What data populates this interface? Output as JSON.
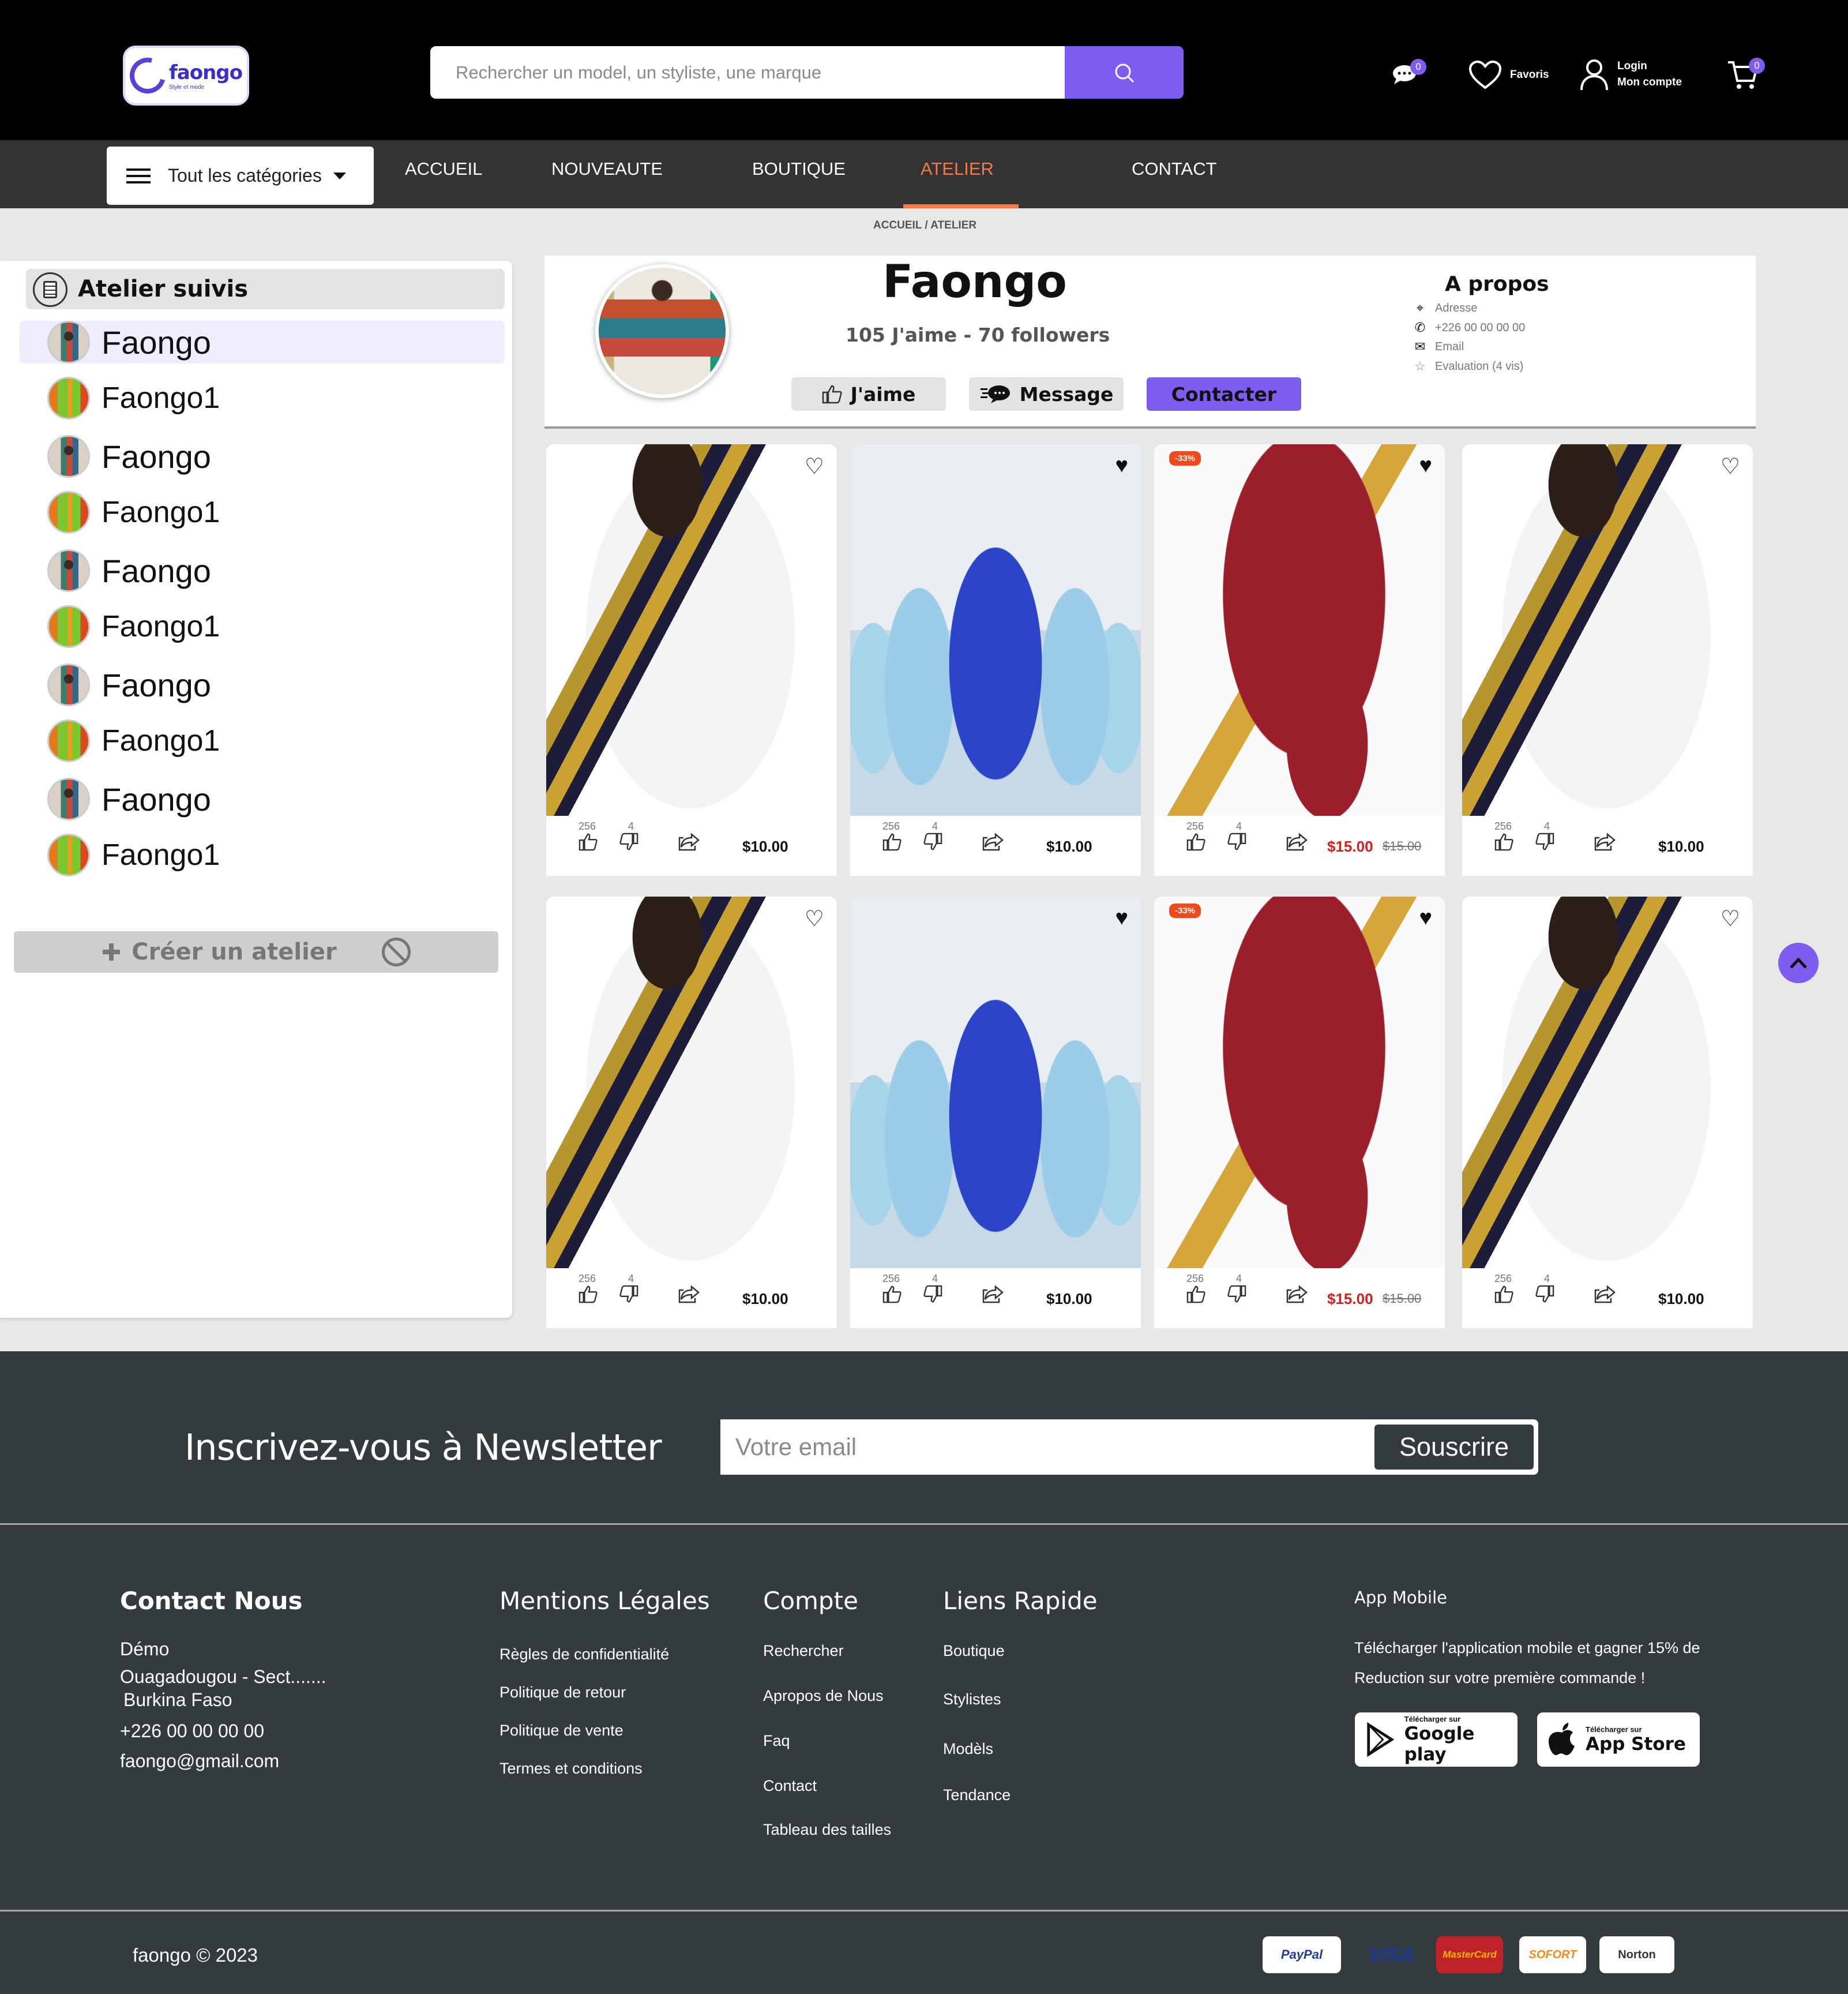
{
  "header": {
    "logo_text": "faongo",
    "logo_tagline": "Style et mode",
    "search_placeholder": "Rechercher un model, un styliste, une marque",
    "messages_badge": "0",
    "favorites_label": "Favoris",
    "login_label": "Login",
    "account_label": "Mon compte",
    "cart_badge": "0"
  },
  "nav": {
    "categories_label": "Tout les catégories",
    "items": [
      "ACCUEIL",
      "NOUVEAUTE",
      "BOUTIQUE",
      "ATELIER",
      "CONTACT"
    ],
    "active": "ATELIER",
    "accent_color": "#f07a4a"
  },
  "breadcrumb": "ACCUEIL / ATELIER",
  "sidebar": {
    "title": "Atelier suivis",
    "items": [
      "Faongo",
      "Faongo1",
      "Faongo",
      "Faongo1",
      "Faongo",
      "Faongo1",
      "Faongo",
      "Faongo1",
      "Faongo",
      "Faongo1"
    ],
    "create_label": "Créer un atelier"
  },
  "profile": {
    "name": "Faongo",
    "stats": "105 J'aime  -  70 followers",
    "like_label": "J'aime",
    "message_label": "Message",
    "contact_label": "Contacter",
    "about": {
      "title": "A propos",
      "address": "Adresse",
      "phone": "+226 00 00 00 00",
      "email": "Email",
      "rating": "Evaluation (4 vis)"
    }
  },
  "products": [
    {
      "image": "white-shirt",
      "liked": false,
      "discount": "",
      "likes": "256",
      "dislikes": "4",
      "price": "$10.00",
      "old_price": ""
    },
    {
      "image": "blue-group",
      "liked": true,
      "discount": "",
      "likes": "256",
      "dislikes": "4",
      "price": "$10.00",
      "old_price": ""
    },
    {
      "image": "red-outfit",
      "liked": true,
      "discount": "-33%",
      "likes": "256",
      "dislikes": "4",
      "price": "$15.00",
      "old_price": "$15.00"
    },
    {
      "image": "white-shirt",
      "liked": false,
      "discount": "",
      "likes": "256",
      "dislikes": "4",
      "price": "$10.00",
      "old_price": ""
    },
    {
      "image": "white-shirt",
      "liked": false,
      "discount": "",
      "likes": "256",
      "dislikes": "4",
      "price": "$10.00",
      "old_price": ""
    },
    {
      "image": "blue-group",
      "liked": true,
      "discount": "",
      "likes": "256",
      "dislikes": "4",
      "price": "$10.00",
      "old_price": ""
    },
    {
      "image": "red-outfit",
      "liked": true,
      "discount": "-33%",
      "likes": "256",
      "dislikes": "4",
      "price": "$15.00",
      "old_price": "$15.00"
    },
    {
      "image": "white-shirt",
      "liked": false,
      "discount": "",
      "likes": "256",
      "dislikes": "4",
      "price": "$10.00",
      "old_price": ""
    }
  ],
  "newsletter": {
    "title": "Inscrivez-vous à Newsletter",
    "placeholder": "Votre email",
    "button": "Souscrire"
  },
  "footer": {
    "contact": {
      "title": "Contact Nous",
      "name": "Démo",
      "address1": "Ouagadougou - Sect.......",
      "address2": "Burkina Faso",
      "phone": "+226 00 00 00 00",
      "email": "faongo@gmail.com"
    },
    "legal": {
      "title": "Mentions Légales",
      "links": [
        "Règles de confidentialité",
        "Politique de retour",
        "Politique de vente",
        "Termes et conditions"
      ]
    },
    "account": {
      "title": "Compte",
      "links": [
        "Rechercher",
        "Apropos de Nous",
        "Faq",
        "Contact",
        "Tableau des tailles"
      ]
    },
    "quick": {
      "title": "Liens Rapide",
      "links": [
        "Boutique",
        "Stylistes",
        "Modèls",
        "Tendance"
      ]
    },
    "app": {
      "title": "App Mobile",
      "text": "Télécharger l'application mobile et gagner 15% de Reduction sur votre première commande !",
      "google_small": "Télécharger sur",
      "google_big": "Google play",
      "apple_small": "Télécharger sur",
      "apple_big": "App Store"
    },
    "copyright": "faongo © 2023",
    "payments": [
      "PayPal",
      "VISA",
      "MasterCard",
      "SOFORT",
      "Norton"
    ]
  }
}
